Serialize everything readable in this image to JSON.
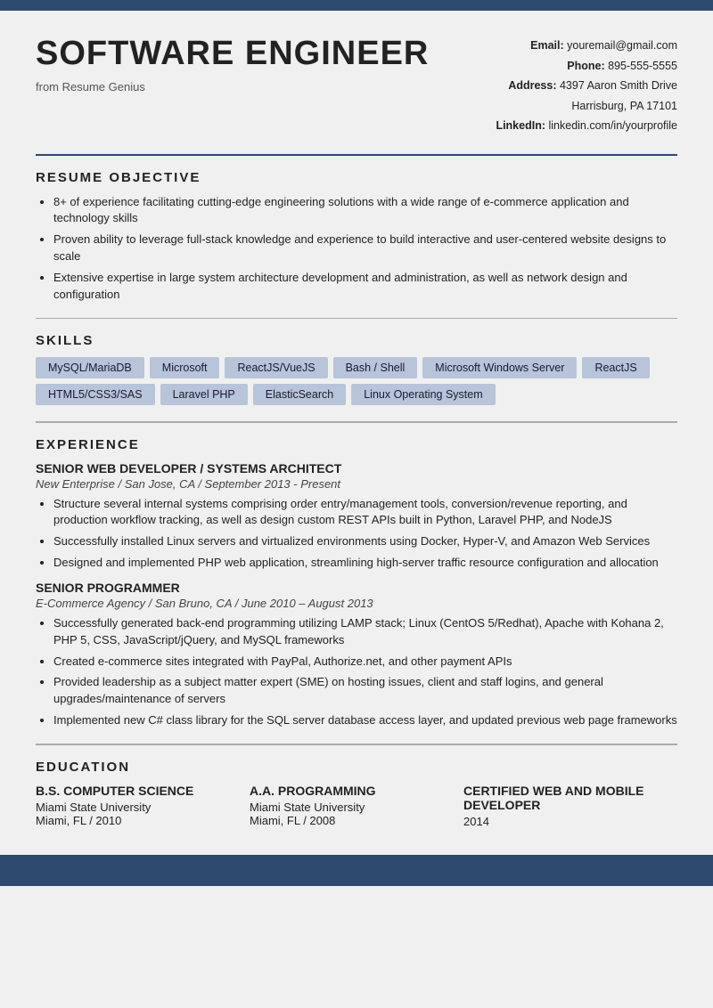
{
  "topBar": {},
  "header": {
    "name": "SOFTWARE ENGINEER",
    "from": "from Resume Genius",
    "contact": {
      "emailLabel": "Email:",
      "email": "youremail@gmail.com",
      "phoneLabel": "Phone:",
      "phone": "895-555-5555",
      "addressLabel": "Address:",
      "address1": "4397 Aaron Smith Drive",
      "address2": "Harrisburg, PA 17101",
      "linkedinLabel": "LinkedIn:",
      "linkedin": "linkedin.com/in/yourprofile"
    }
  },
  "objective": {
    "sectionTitle": "RESUME OBJECTIVE",
    "bullets": [
      "8+ of experience facilitating cutting-edge engineering solutions with a wide range of e-commerce application and technology skills",
      "Proven ability to leverage full-stack knowledge and experience to build interactive and user-centered website designs to scale",
      "Extensive expertise in large system architecture development and administration, as well as network design and configuration"
    ]
  },
  "skills": {
    "sectionTitle": "SKILLS",
    "items": [
      "MySQL/MariaDB",
      "Microsoft",
      "ReactJS/VueJS",
      "Bash / Shell",
      "Microsoft Windows Server",
      "ReactJS",
      "HTML5/CSS3/SAS",
      "Laravel PHP",
      "ElasticSearch",
      "Linux Operating System"
    ]
  },
  "experience": {
    "sectionTitle": "EXPERIENCE",
    "jobs": [
      {
        "title": "SENIOR WEB DEVELOPER / SYSTEMS ARCHITECT",
        "meta": "New Enterprise / San Jose, CA / September 2013 - Present",
        "bullets": [
          "Structure several internal systems comprising order entry/management tools, conversion/revenue reporting, and production workflow tracking, as well as design custom REST APIs built in Python, Laravel PHP, and NodeJS",
          "Successfully installed Linux servers and virtualized environments using Docker, Hyper-V, and Amazon Web Services",
          "Designed and implemented PHP web application, streamlining high-server traffic resource configuration and allocation"
        ]
      },
      {
        "title": "SENIOR PROGRAMMER",
        "meta": "E-Commerce Agency / San Bruno, CA / June 2010 – August 2013",
        "bullets": [
          "Successfully generated back-end programming utilizing LAMP stack; Linux (CentOS 5/Redhat), Apache with Kohana 2, PHP 5, CSS, JavaScript/jQuery, and MySQL frameworks",
          "Created e-commerce sites integrated with PayPal, Authorize.net, and other payment APIs",
          "Provided leadership as a subject matter expert (SME) on hosting issues, client and staff logins, and general upgrades/maintenance of servers",
          "Implemented new C# class library for the SQL server database access layer, and updated previous web page frameworks"
        ]
      }
    ]
  },
  "education": {
    "sectionTitle": "EDUCATION",
    "degrees": [
      {
        "degree": "B.S. COMPUTER SCIENCE",
        "school": "Miami State University",
        "location": "Miami, FL / 2010"
      },
      {
        "degree": "A.A. PROGRAMMING",
        "school": "Miami State University",
        "location": "Miami, FL / 2008"
      },
      {
        "degree": "CERTIFIED WEB AND MOBILE DEVELOPER",
        "school": "",
        "location": "2014"
      }
    ]
  }
}
